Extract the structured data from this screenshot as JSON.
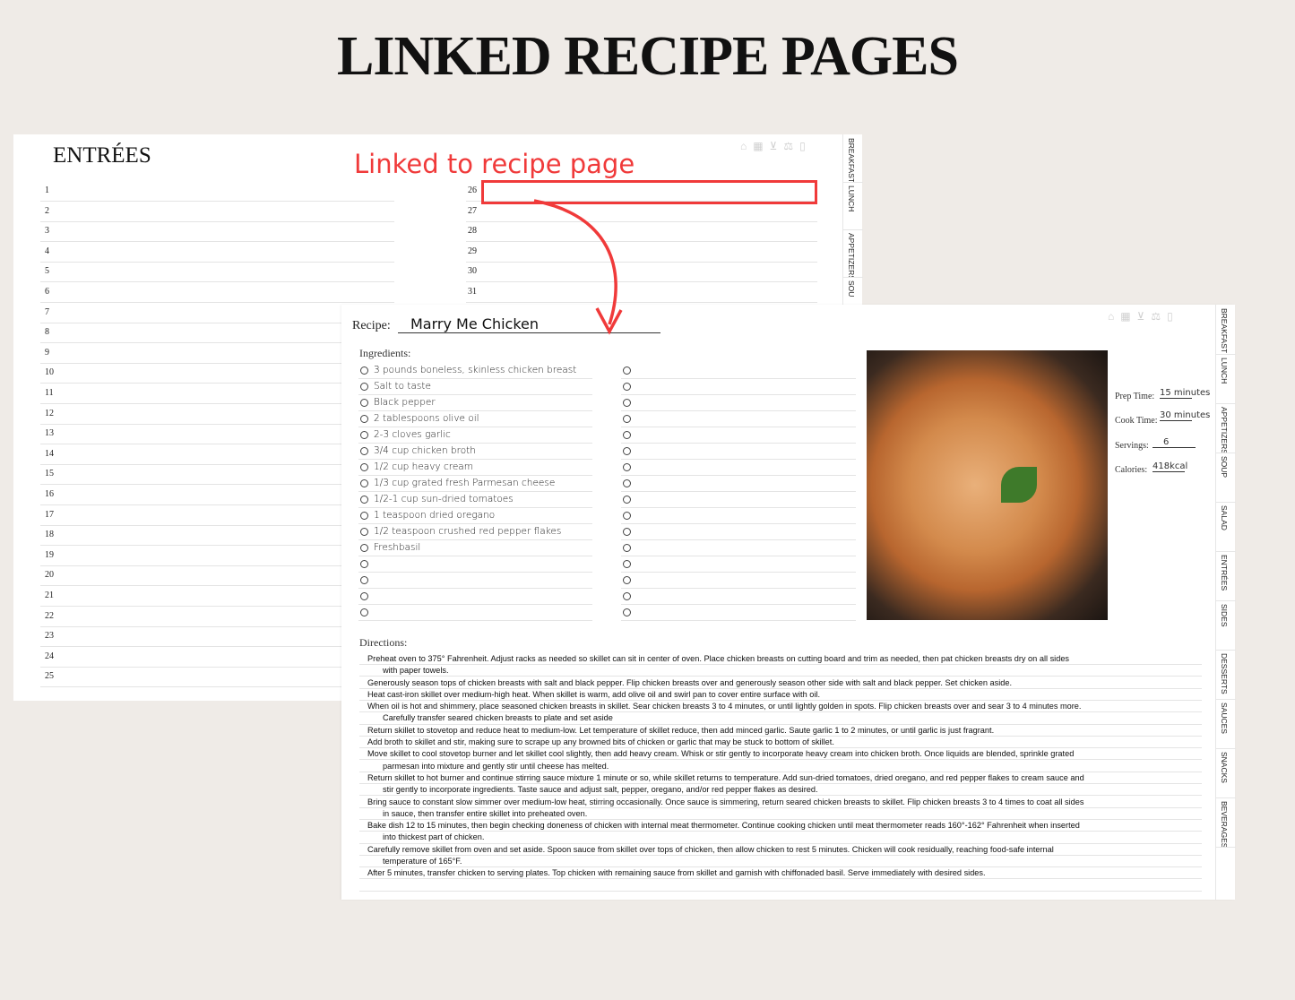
{
  "heading": "LINKED RECIPE PAGES",
  "annotation": {
    "text": "Linked to recipe page",
    "color": "#f03a3a"
  },
  "nav_icons": [
    "home-icon",
    "calendar-icon",
    "basket-icon",
    "scale-icon",
    "notes-icon"
  ],
  "index_page": {
    "title": "ENTRÉES",
    "left_numbers": [
      "1",
      "2",
      "3",
      "4",
      "5",
      "6",
      "7",
      "8",
      "9",
      "10",
      "11",
      "12",
      "13",
      "14",
      "15",
      "16",
      "17",
      "18",
      "19",
      "20",
      "21",
      "22",
      "23",
      "24",
      "25"
    ],
    "right_numbers": [
      "26",
      "27",
      "28",
      "29",
      "30",
      "31"
    ],
    "tabs": [
      "BREAKFAST",
      "LUNCH",
      "APPETIZERS",
      "SOU"
    ]
  },
  "recipe_page": {
    "recipe_label": "Recipe:",
    "recipe_name": "Marry Me Chicken",
    "ingredients_label": "Ingredients:",
    "ingredients": [
      "3 pounds boneless, skinless chicken breast",
      "Salt to taste",
      "Black pepper",
      "2 tablespoons olive oil",
      "2-3 cloves garlic",
      "3/4 cup chicken broth",
      "1/2 cup heavy cream",
      "1/3 cup grated fresh Parmesan cheese",
      "1/2-1 cup sun-dried tomatoes",
      "1 teaspoon dried oregano",
      "1/2 teaspoon crushed red pepper flakes",
      "Freshbasil",
      "",
      "",
      "",
      ""
    ],
    "prep_time_label": "Prep Time:",
    "prep_time": "15 minutes",
    "cook_time_label": "Cook Time:",
    "cook_time": "30 minutes",
    "servings_label": "Servings:",
    "servings": "6",
    "calories_label": "Calories:",
    "calories": "418kcal",
    "directions_label": "Directions:",
    "directions": [
      [
        "Preheat oven to 375° Fahrenheit. Adjust racks as needed so skillet can sit in center of oven. Place chicken breasts on cutting board and trim as needed, then pat chicken breasts dry on all sides",
        "with paper towels."
      ],
      [
        "Generously season tops of chicken breasts with salt and black pepper. Flip chicken breasts over and generously season other side with salt and black pepper. Set chicken aside.",
        ""
      ],
      [
        "Heat cast-iron skillet over medium-high heat. When skillet is warm, add olive oil and swirl pan to cover entire surface with oil.",
        ""
      ],
      [
        "When oil is hot and shimmery, place seasoned chicken breasts in skillet. Sear chicken breasts 3 to 4 minutes, or until lightly golden in spots. Flip chicken breasts over and sear 3 to 4 minutes more.",
        "Carefully transfer seared chicken breasts to plate and set aside"
      ],
      [
        "Return skillet to stovetop and reduce heat to medium-low. Let temperature of skillet reduce, then add minced garlic. Saute garlic 1 to 2 minutes, or until garlic is just fragrant.",
        ""
      ],
      [
        "Add broth to skillet and stir, making sure to scrape up any browned bits of chicken or garlic that may be stuck to bottom of skillet.",
        ""
      ],
      [
        "Move skillet to cool stovetop burner and let skillet cool slightly, then add heavy cream. Whisk or stir gently to incorporate heavy cream into chicken broth. Once liquids are blended, sprinkle grated",
        "parmesan into mixture and gently stir until cheese has melted."
      ],
      [
        "Return skillet to hot burner and continue stirring sauce mixture 1 minute or so, while skillet returns to temperature. Add sun-dried tomatoes, dried oregano, and red pepper flakes to cream sauce and",
        "stir gently to incorporate ingredients. Taste sauce and adjust salt, pepper, oregano, and/or red pepper flakes as desired."
      ],
      [
        "Bring sauce to constant slow simmer over medium-low heat, stirring occasionally. Once sauce is simmering, return seared chicken breasts to skillet. Flip chicken breasts 3 to 4 times to coat all sides",
        "in sauce, then transfer entire skillet into preheated oven."
      ],
      [
        "Bake dish 12 to 15 minutes, then begin checking doneness of chicken with internal meat thermometer. Continue cooking chicken until meat thermometer reads 160°-162° Fahrenheit when inserted",
        "into thickest part of chicken."
      ],
      [
        "Carefully remove skillet from oven and set aside. Spoon sauce from skillet over tops of chicken, then allow chicken to rest 5 minutes. Chicken will cook residually, reaching food-safe internal",
        "temperature of 165°F."
      ],
      [
        "After 5 minutes, transfer chicken to serving plates. Top chicken with remaining sauce from skillet and garnish with chiffonaded basil. Serve immediately with desired sides.",
        ""
      ]
    ],
    "tabs": [
      "BREAKFAST",
      "LUNCH",
      "APPETIZERS",
      "SOUP",
      "SALAD",
      "ENTRÉES",
      "SIDES",
      "DESSERTS",
      "SAUCES",
      "SNACKS",
      "BEVERAGES"
    ]
  }
}
